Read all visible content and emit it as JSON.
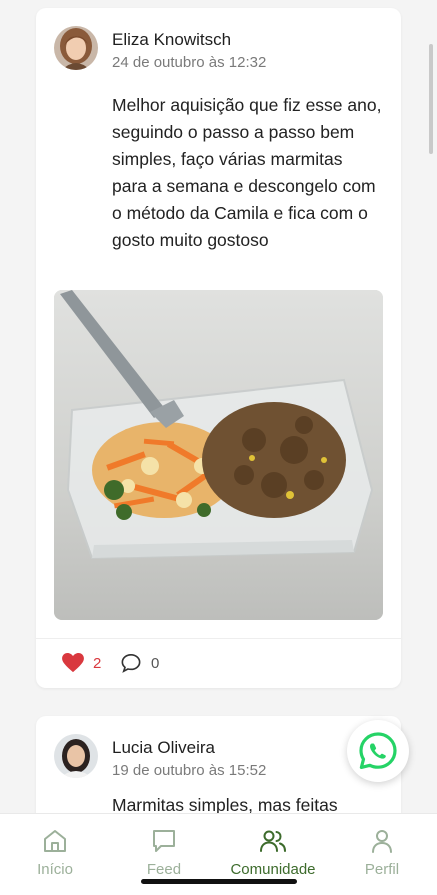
{
  "feed": {
    "posts": [
      {
        "author": "Eliza Knowitsch",
        "date": "24 de outubro às 12:32",
        "text": "Melhor aquisição que fiz esse ano, seguindo o passo a passo bem simples, faço várias marmitas para a semana e descongelo com o método da Camila e fica com o gosto muito gostoso",
        "likes": "2",
        "comments": "0"
      },
      {
        "author": "Lucia Oliveira",
        "date": "19 de outubro às 15:52",
        "text": "Marmitas simples, mas feitas"
      }
    ]
  },
  "nav": {
    "items": [
      {
        "label": "Início",
        "icon": "home-icon"
      },
      {
        "label": "Feed",
        "icon": "chat-icon"
      },
      {
        "label": "Comunidade",
        "icon": "users-icon"
      },
      {
        "label": "Perfil",
        "icon": "user-icon"
      }
    ],
    "active": "Comunidade"
  },
  "colors": {
    "accent": "#3d6b2c",
    "inactive": "#9cb09a",
    "like": "#d9383e",
    "whatsapp": "#25d366"
  }
}
